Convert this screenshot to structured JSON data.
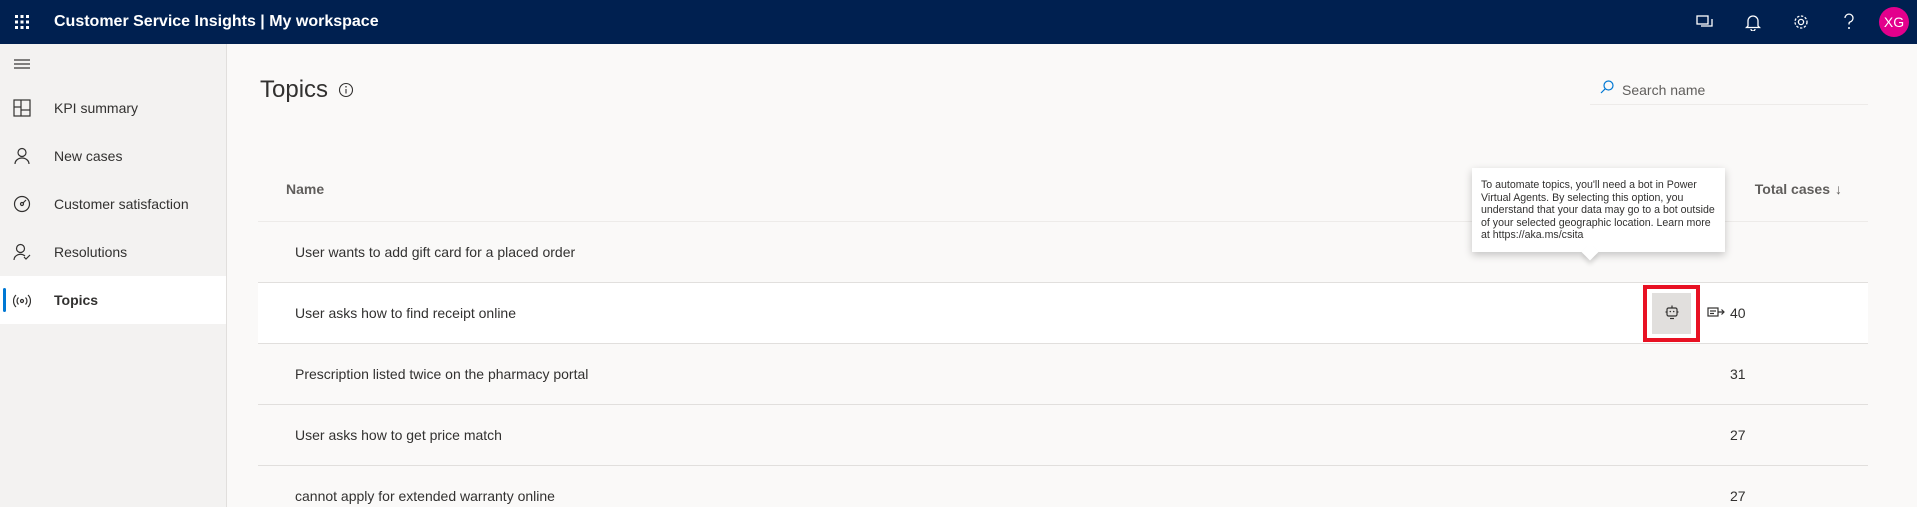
{
  "app": {
    "title": "Customer Service Insights | My workspace"
  },
  "header": {
    "icons": [
      "chat-icon",
      "bell-icon",
      "gear-icon",
      "help-icon"
    ],
    "user_initials": "XG",
    "avatar_color": "#e3008c",
    "bar_color": "#002050"
  },
  "sidebar": {
    "items": [
      {
        "label": "KPI summary",
        "icon": "dashboard-icon"
      },
      {
        "label": "New cases",
        "icon": "person-icon"
      },
      {
        "label": "Customer satisfaction",
        "icon": "gauge-icon"
      },
      {
        "label": "Resolutions",
        "icon": "person-check-icon"
      },
      {
        "label": "Topics",
        "icon": "broadcast-icon",
        "active": true
      }
    ]
  },
  "main": {
    "title": "Topics",
    "search": {
      "placeholder": "Search name"
    },
    "table": {
      "columns": {
        "name": "Name",
        "total_cases": "Total cases",
        "sort_indicator": "↓"
      },
      "rows": [
        {
          "name": "User wants to add gift card for a placed order",
          "total": ""
        },
        {
          "name": "User asks how to find receipt online",
          "total": "40"
        },
        {
          "name": "Prescription listed twice on the pharmacy portal",
          "total": "31"
        },
        {
          "name": "User asks how to get price match",
          "total": "27"
        },
        {
          "name": "cannot apply for extended warranty online",
          "total": "27"
        }
      ]
    },
    "tooltip": {
      "text": "To automate topics, you'll need a bot in Power Virtual Agents. By selecting this option, you understand that your data may go to a bot outside of your selected geographic location. Learn more at https://aka.ms/csita"
    },
    "highlight_color": "#e81123"
  }
}
